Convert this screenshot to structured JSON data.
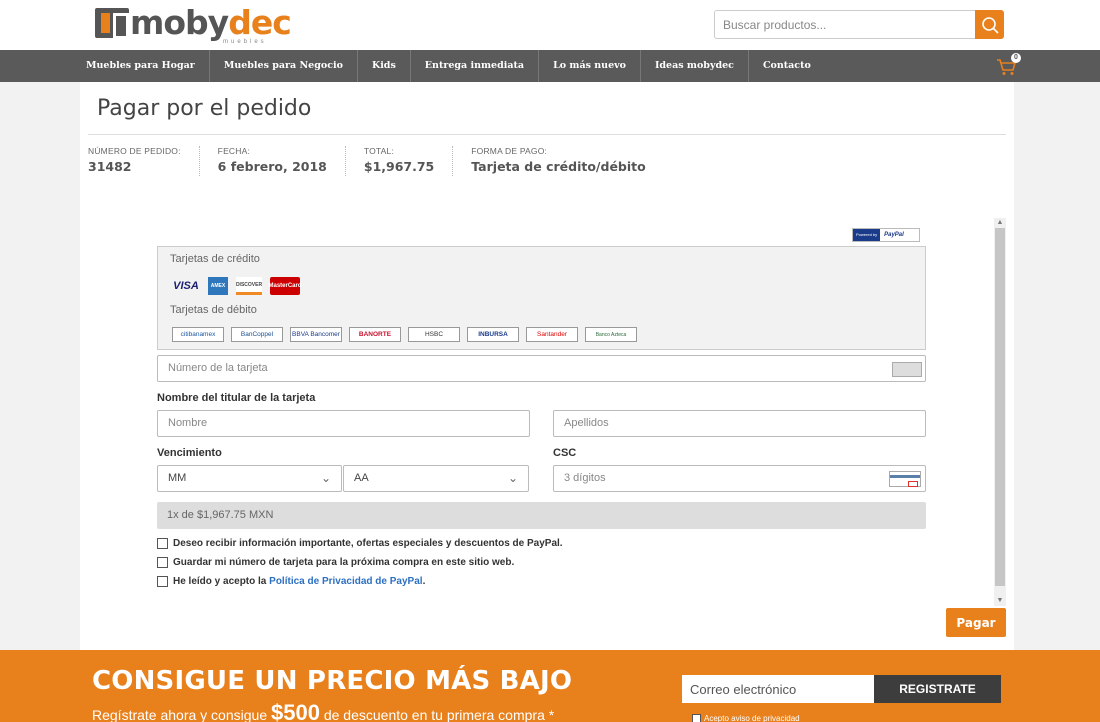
{
  "header": {
    "logo_main": "moby",
    "logo_accent": "dec",
    "logo_sub": "muebles",
    "search_placeholder": "Buscar productos..."
  },
  "nav": {
    "items": [
      {
        "label": "Muebles para Hogar"
      },
      {
        "label": "Muebles para Negocio"
      },
      {
        "label": "Kids"
      },
      {
        "label": "Entrega inmediata"
      },
      {
        "label": "Lo más nuevo"
      },
      {
        "label": "Ideas mobydec"
      },
      {
        "label": "Contacto"
      }
    ],
    "cart_count": "0"
  },
  "page": {
    "title": "Pagar por el pedido",
    "order": {
      "number_label": "NÚMERO DE PEDIDO:",
      "number": "31482",
      "date_label": "FECHA:",
      "date": "6 febrero, 2018",
      "total_label": "TOTAL:",
      "total": "$1,967.75",
      "payment_label": "FORMA DE PAGO:",
      "payment": "Tarjeta de crédito/débito"
    }
  },
  "paypal": {
    "powered_by": "Powered by",
    "brand": "PayPal",
    "credit_label": "Tarjetas de crédito",
    "debit_label": "Tarjetas de débito",
    "credit_cards": [
      "VISA",
      "AMEX",
      "DISCOVER",
      "MasterCard"
    ],
    "debit_cards": [
      "citibanamex",
      "BanCoppel",
      "BBVA Bancomer",
      "BANORTE",
      "HSBC",
      "INBURSA",
      "Santander",
      "Banco Azteca"
    ],
    "card_number_placeholder": "Número de la tarjeta",
    "holder_label": "Nombre del titular de la tarjeta",
    "first_name_placeholder": "Nombre",
    "last_name_placeholder": "Apellidos",
    "expiry_label": "Vencimiento",
    "month_value": "MM",
    "year_value": "AA",
    "csc_label": "CSC",
    "csc_placeholder": "3 dígitos",
    "installments": "1x de $1,967.75 MXN",
    "checks": {
      "offers": "Deseo recibir información importante, ofertas especiales y descuentos de PayPal.",
      "save_card": "Guardar mi número de tarjeta para la próxima compra en este sitio web.",
      "privacy_pre": "He leído y acepto la ",
      "privacy_link": "Política de Privacidad de PayPal",
      "privacy_post": "."
    }
  },
  "pay_button": "Pagar",
  "promo": {
    "title": "CONSIGUE UN PRECIO MÁS BAJO",
    "sub_pre": "Regístrate ahora y consigue ",
    "sub_amount": "$500",
    "sub_post": " de descuento en tu primera compra *",
    "email_placeholder": "Correo electrónico",
    "register": "REGISTRATE",
    "privacy": "Acepto aviso de privacidad"
  },
  "colors": {
    "accent": "#e8801c",
    "nav_bg": "#5a5a5a",
    "link": "#2c70c1"
  }
}
